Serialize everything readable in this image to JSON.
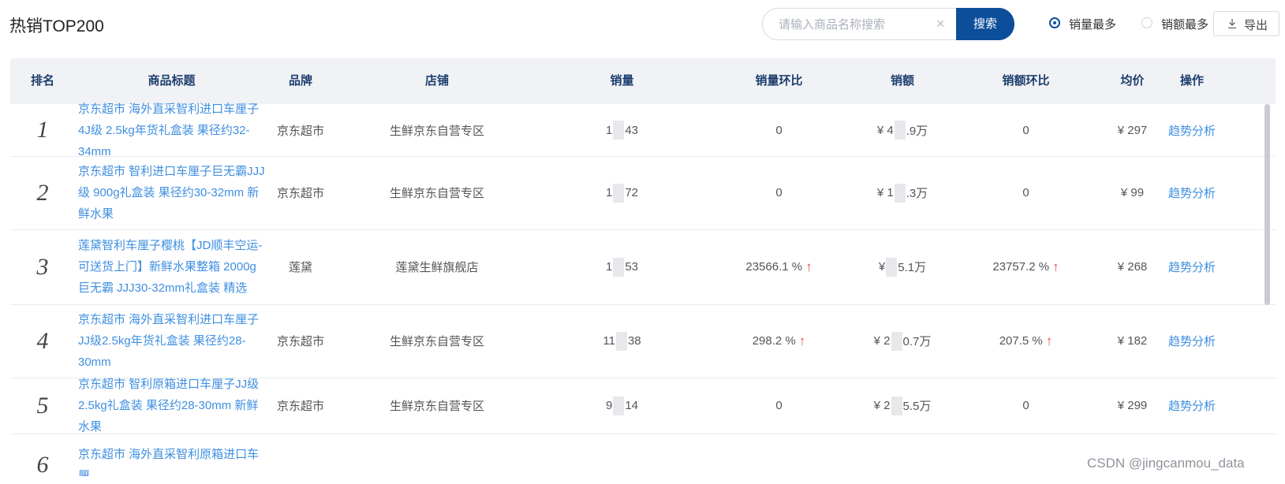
{
  "page": {
    "title": "热销TOP200"
  },
  "search": {
    "placeholder": "请输入商品名称搜索",
    "clear_icon": "×",
    "button": "搜索"
  },
  "sort": [
    {
      "label": "销量最多",
      "selected": true
    },
    {
      "label": "销额最多",
      "selected": false
    }
  ],
  "export": {
    "label": "导出",
    "icon": "download-icon"
  },
  "table": {
    "headers": {
      "rank": "排名",
      "title": "商品标题",
      "brand": "品牌",
      "shop": "店铺",
      "sales": "销量",
      "sales_mom": "销量环比",
      "amount": "销额",
      "amount_mom": "销额环比",
      "avg_price": "均价",
      "action": "操作"
    },
    "rows": [
      {
        "rank": "1",
        "title": "京东超市 海外直采智利进口车厘子4J级 2.5kg年货礼盒装 果径约32-34mm",
        "brand": "京东超市",
        "shop": "生鲜京东自营专区",
        "sales_a": "1",
        "sales_b": "43",
        "sales_mom": "0",
        "sales_mom_up": false,
        "amount_a": "¥ 4",
        "amount_b": ".9万",
        "amount_mom": "0",
        "amount_mom_up": false,
        "avg_price": "¥ 297",
        "action": "趋势分析"
      },
      {
        "rank": "2",
        "title": "京东超市 智利进口车厘子巨无霸JJJ级 900g礼盒装 果径约30-32mm 新鲜水果",
        "brand": "京东超市",
        "shop": "生鲜京东自营专区",
        "sales_a": "1",
        "sales_b": "72",
        "sales_mom": "0",
        "sales_mom_up": false,
        "amount_a": "¥ 1",
        "amount_b": ".3万",
        "amount_mom": "0",
        "amount_mom_up": false,
        "avg_price": "¥ 99",
        "action": "趋势分析"
      },
      {
        "rank": "3",
        "title": "莲黛智利车厘子樱桃【JD顺丰空运-可送货上门】新鲜水果整箱 2000g巨无霸 JJJ30-32mm礼盒装 精选",
        "brand": "莲黛",
        "shop": "莲黛生鲜旗舰店",
        "sales_a": "1",
        "sales_b": "53",
        "sales_mom": "23566.1 %",
        "sales_mom_up": true,
        "amount_a": "¥ ",
        "amount_b": "5.1万",
        "amount_mom": "23757.2 %",
        "amount_mom_up": true,
        "avg_price": "¥ 268",
        "action": "趋势分析"
      },
      {
        "rank": "4",
        "title": "京东超市 海外直采智利进口车厘子 JJ级2.5kg年货礼盒装 果径约28-30mm",
        "brand": "京东超市",
        "shop": "生鲜京东自营专区",
        "sales_a": "11",
        "sales_b": "38",
        "sales_mom": "298.2 %",
        "sales_mom_up": true,
        "amount_a": "¥ 2",
        "amount_b": "0.7万",
        "amount_mom": "207.5 %",
        "amount_mom_up": true,
        "avg_price": "¥ 182",
        "action": "趋势分析"
      },
      {
        "rank": "5",
        "title": "京东超市 智利原箱进口车厘子JJ级 2.5kg礼盒装 果径约28-30mm 新鲜水果",
        "brand": "京东超市",
        "shop": "生鲜京东自营专区",
        "sales_a": "9",
        "sales_b": "14",
        "sales_mom": "0",
        "sales_mom_up": false,
        "amount_a": "¥ 2",
        "amount_b": "5.5万",
        "amount_mom": "0",
        "amount_mom_up": false,
        "avg_price": "¥ 299",
        "action": "趋势分析"
      },
      {
        "rank": "6",
        "title": "京东超市 海外直采智利原箱进口车厘",
        "brand": "",
        "shop": "",
        "sales_a": "",
        "sales_b": "",
        "sales_mom": "",
        "sales_mom_up": false,
        "amount_a": "",
        "amount_b": "",
        "amount_mom": "",
        "amount_mom_up": false,
        "avg_price": "",
        "action": ""
      }
    ]
  },
  "watermark": "CSDN @jingcanmou_data",
  "colors": {
    "primary": "#0c4e9a",
    "link": "#3f8fe0",
    "up": "#e84a4a",
    "header_bg": "#f0f2f5"
  }
}
